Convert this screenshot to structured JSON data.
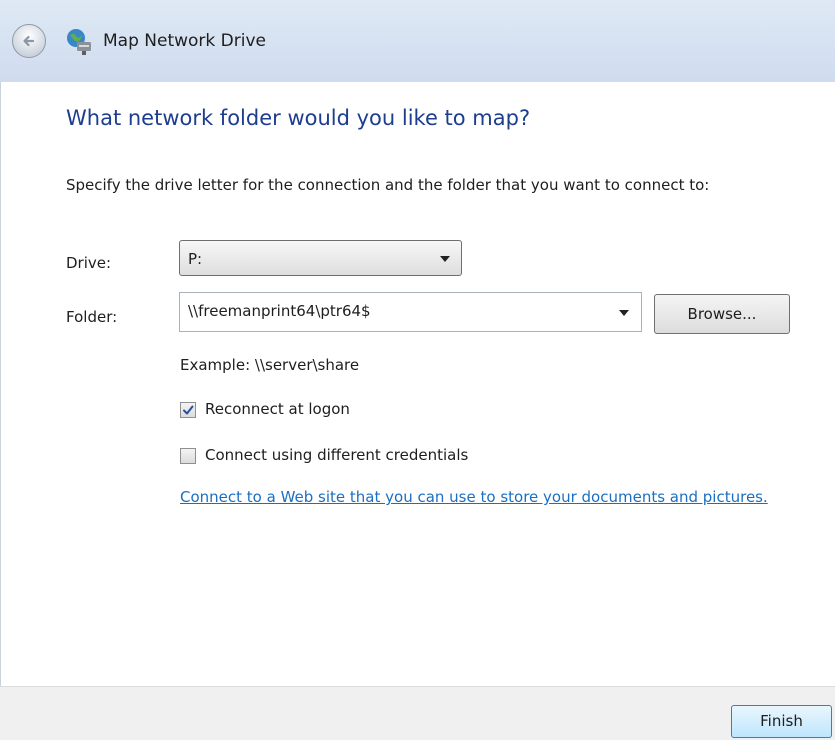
{
  "window": {
    "title": "Map Network Drive",
    "back_icon": "back-arrow-icon",
    "app_icon": "network-drive-icon"
  },
  "page": {
    "heading": "What network folder would you like to map?",
    "instructions": "Specify the drive letter for the connection and the folder that you want to connect to:"
  },
  "form": {
    "drive_label": "Drive:",
    "drive_value": "P:",
    "folder_label": "Folder:",
    "folder_value": "\\\\freemanprint64\\ptr64$",
    "browse_label": "Browse...",
    "example": "Example: \\\\server\\share",
    "reconnect_label": "Reconnect at logon",
    "reconnect_checked": true,
    "credentials_label": "Connect using different credentials",
    "credentials_checked": false,
    "web_link": "Connect to a Web site that you can use to store your documents and pictures."
  },
  "footer": {
    "finish_label": "Finish"
  },
  "colors": {
    "heading": "#1d3d8f",
    "link": "#1a6fc4",
    "titlebar": "#dfe9f5"
  }
}
